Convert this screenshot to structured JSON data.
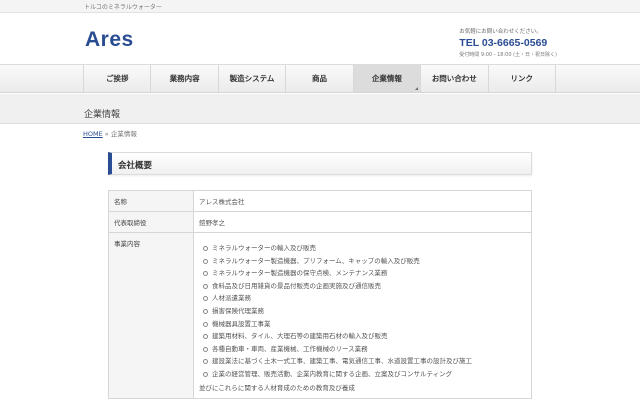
{
  "header": {
    "tagline": "トルコのミネラルウォーター",
    "logo": "Ares",
    "contact_note": "お気軽にお問い合わせください。",
    "tel": "TEL 03-6665-0569",
    "hours": "受付時間 9:00 - 18:00 (土・日・祝日除く)"
  },
  "nav": {
    "items": [
      {
        "label": "ご挨拶"
      },
      {
        "label": "業務内容"
      },
      {
        "label": "製造システム"
      },
      {
        "label": "商品"
      },
      {
        "label": "企業情報"
      },
      {
        "label": "お問い合わせ"
      },
      {
        "label": "リンク"
      }
    ],
    "active_index": 4
  },
  "page": {
    "title": "企業情報",
    "breadcrumb_home": "HOME",
    "breadcrumb_sep": " » ",
    "breadcrumb_current": "企業情報"
  },
  "section": {
    "heading": "会社概要"
  },
  "table": {
    "name_label": "名称",
    "name_value": "アレス株式会社",
    "rep_label": "代表取締役",
    "rep_value": "鎧野孝之",
    "business_label": "事業内容",
    "business_items": [
      "ミネラルウォーターの輸入及び販売",
      "ミネラルウォーター製造機器、プリフォーム、キャップの輸入及び販売",
      "ミネラルウォーター製造機器の保守点検、メンテナンス業務",
      "食料品及び日用雑貨の景品付販売の企画実施及び通信販売",
      "人材派遣業務",
      "損害保険代理業務",
      "機械器具設置工事業",
      "建築用材料、タイル、大理石等の建築用石材の輸入及び販売",
      "各種自動車・車両、産業機械、工作機械のリース業務",
      "建設業法に基づく土木一式工事、建築工事、電気通信工事、水道設置工事の設計及び施工",
      "企業の経営管理、販売活動、企業内教育に関する企画、立案及びコンサルティング"
    ],
    "business_extra": "並びにこれらに関する人材育成のための教育及び養成"
  },
  "colors": {
    "brand": "#2a4c93"
  }
}
